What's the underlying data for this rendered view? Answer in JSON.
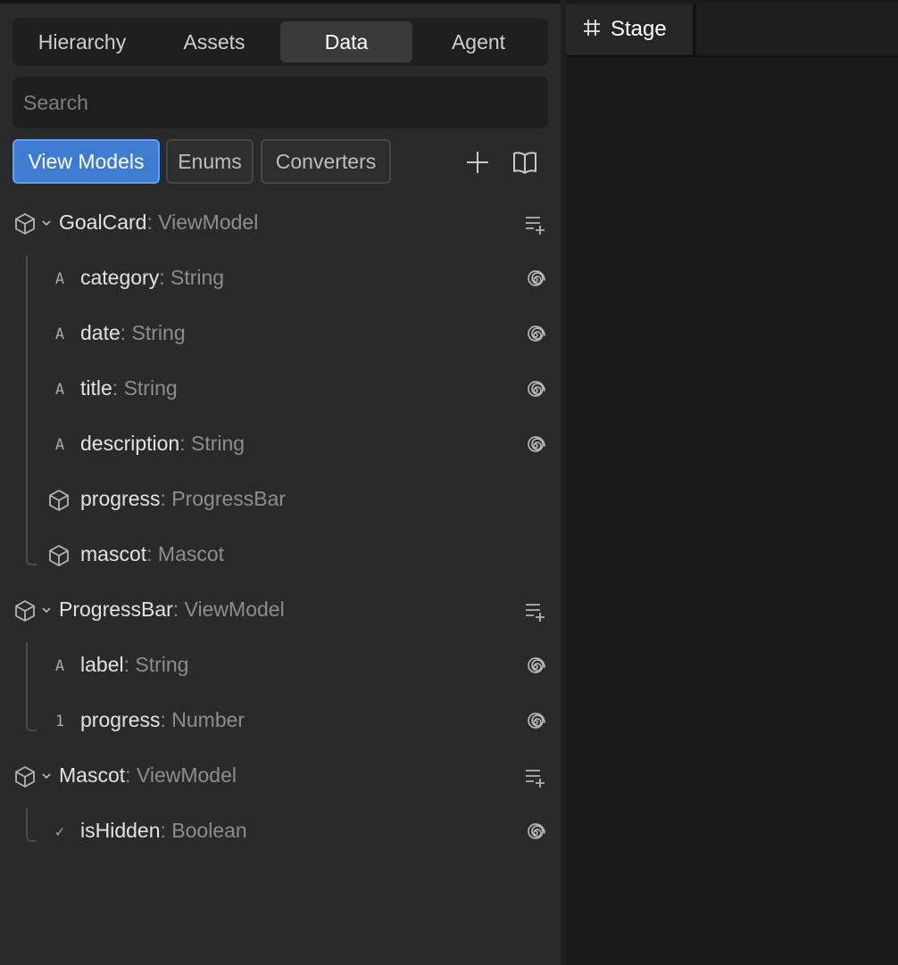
{
  "tabs": [
    {
      "label": "Hierarchy"
    },
    {
      "label": "Assets"
    },
    {
      "label": "Data"
    },
    {
      "label": "Agent"
    }
  ],
  "search": {
    "placeholder": "Search"
  },
  "segments": [
    {
      "label": "View Models"
    },
    {
      "label": "Enums"
    },
    {
      "label": "Converters"
    }
  ],
  "tree": {
    "goalcard": {
      "name": "GoalCard",
      "type": ": ViewModel",
      "fields": [
        {
          "name": "category",
          "type": ": String",
          "glyph": "A"
        },
        {
          "name": "date",
          "type": ": String",
          "glyph": "A"
        },
        {
          "name": "title",
          "type": ": String",
          "glyph": "A"
        },
        {
          "name": "description",
          "type": ": String",
          "glyph": "A"
        },
        {
          "name": "progress",
          "type": ": ProgressBar",
          "glyph": ""
        },
        {
          "name": "mascot",
          "type": ": Mascot",
          "glyph": ""
        }
      ]
    },
    "progressbar": {
      "name": "ProgressBar",
      "type": ": ViewModel",
      "fields": [
        {
          "name": "label",
          "type": ": String",
          "glyph": "A"
        },
        {
          "name": "progress",
          "type": ": Number",
          "glyph": "1"
        }
      ]
    },
    "mascot": {
      "name": "Mascot",
      "type": ": ViewModel",
      "fields": [
        {
          "name": "isHidden",
          "type": ": Boolean",
          "glyph": "✓"
        }
      ]
    }
  },
  "stage": {
    "tab_label": "Stage"
  },
  "colors": {
    "accent": "#3f7bd0",
    "panel": "#2a2a2a",
    "stage": "#1a1a1a"
  }
}
